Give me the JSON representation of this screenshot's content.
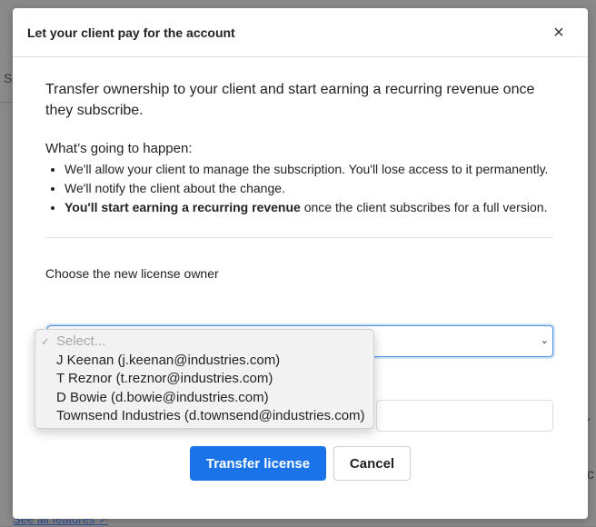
{
  "background": {
    "fragment_s": "S",
    "fragment_c": "c",
    "see_all_link": "See all features ↗"
  },
  "modal": {
    "title": "Let your client pay for the account",
    "close_icon": "×",
    "intro": "Transfer ownership to your client and start earning a recurring revenue once they subscribe.",
    "happen_title": "What’s going to happen:",
    "bullets": [
      {
        "bold": "",
        "text": "We'll allow your client to manage the subscription. You'll lose access to it permanently."
      },
      {
        "bold": "",
        "text": "We'll notify the client about the change."
      },
      {
        "bold": "You'll start earning a recurring revenue",
        "text": " once the client subscribes for a full version."
      }
    ],
    "owner_label": "Choose the new license owner",
    "dropdown": {
      "selected": "Select...",
      "options": [
        "Select...",
        "J Keenan (j.keenan@industries.com)",
        "T Reznor (t.reznor@industries.com)",
        "D Bowie (d.bowie@industries.com)",
        "Townsend Industries (d.townsend@industries.com)"
      ]
    },
    "primary_button": "Transfer license",
    "cancel_button": "Cancel"
  },
  "colors": {
    "accent": "#1a73e8",
    "focus_border": "#4a90e2",
    "overlay": "#8a8a8a"
  }
}
